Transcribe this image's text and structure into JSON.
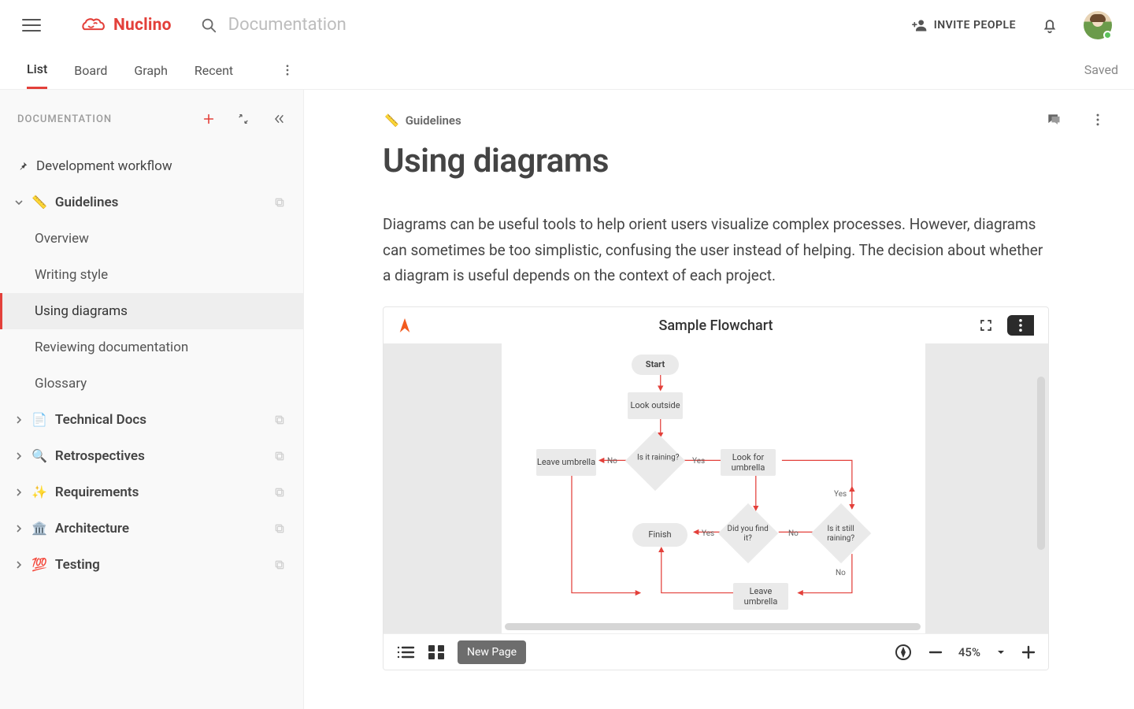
{
  "header": {
    "brand": "Nuclino",
    "search_placeholder": "Documentation",
    "invite_label": "INVITE PEOPLE"
  },
  "tabs": {
    "items": [
      "List",
      "Board",
      "Graph",
      "Recent"
    ],
    "active": 0,
    "status": "Saved"
  },
  "sidebar": {
    "title": "DOCUMENTATION",
    "pinned": {
      "label": "Development workflow"
    },
    "sections": [
      {
        "emoji": "📏",
        "label": "Guidelines",
        "expanded": true,
        "children": [
          "Overview",
          "Writing style",
          "Using diagrams",
          "Reviewing documentation",
          "Glossary"
        ],
        "activeChild": 2
      },
      {
        "emoji": "📄",
        "label": "Technical Docs"
      },
      {
        "emoji": "🔍",
        "label": "Retrospectives"
      },
      {
        "emoji": "✨",
        "label": "Requirements"
      },
      {
        "emoji": "🏛️",
        "label": "Architecture"
      },
      {
        "emoji": "💯",
        "label": "Testing"
      }
    ]
  },
  "doc": {
    "breadcrumb_emoji": "📏",
    "breadcrumb": "Guidelines",
    "title": "Using diagrams",
    "paragraph": "Diagrams can be useful tools to help orient users visualize complex processes. However, diagrams can sometimes be too simplistic, confusing the user instead of helping. The decision about whether a diagram is useful depends on the context of each project."
  },
  "embed": {
    "title": "Sample Flowchart",
    "new_page": "New Page",
    "zoom": "45%",
    "flow": {
      "start": "Start",
      "look_outside": "Look outside",
      "is_raining": "Is it raining?",
      "leave_umbrella": "Leave umbrella",
      "look_for_umbrella": "Look for umbrella",
      "did_find": "Did you find it?",
      "still_raining": "Is it still raining?",
      "finish": "Finish",
      "leave_umbrella2": "Leave umbrella",
      "yes": "Yes",
      "no": "No"
    }
  }
}
